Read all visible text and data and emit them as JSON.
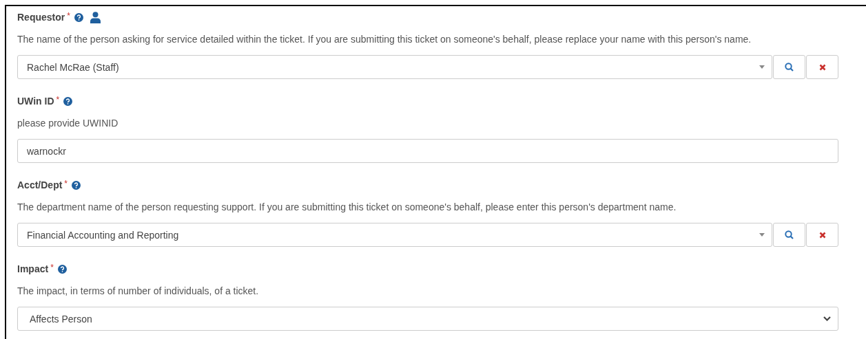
{
  "fields": [
    {
      "kind": "lookup",
      "label": "Requestor",
      "required_mark": "*",
      "person_icon": true,
      "description": "The name of the person asking for service detailed within the ticket. If you are submitting this ticket on someone's behalf, please replace your name with this person's name.",
      "value": "Rachel McRae (Staff)"
    },
    {
      "kind": "text",
      "label": "UWin ID",
      "required_mark": "*",
      "person_icon": false,
      "description": "please provide UWINID",
      "value": "warnockr"
    },
    {
      "kind": "lookup",
      "label": "Acct/Dept",
      "required_mark": "*",
      "person_icon": false,
      "description": "The department name of the person requesting support. If you are submitting this ticket on someone's behalf, please enter this person's department name.",
      "value": "Financial Accounting and Reporting"
    },
    {
      "kind": "select",
      "label": "Impact",
      "required_mark": "*",
      "person_icon": false,
      "description": "The impact, in terms of number of individuals, of a ticket.",
      "value": "Affects Person"
    }
  ]
}
